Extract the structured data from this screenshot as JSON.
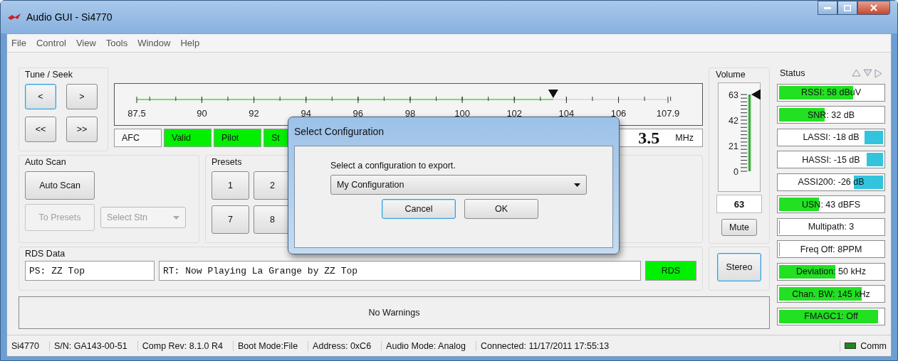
{
  "window": {
    "title": "Audio GUI - Si4770"
  },
  "menu": [
    "File",
    "Control",
    "View",
    "Tools",
    "Window",
    "Help"
  ],
  "tune_seek": {
    "title": "Tune / Seek",
    "buttons": [
      {
        "label": "<",
        "focused": true
      },
      {
        "label": ">",
        "focused": false
      },
      {
        "label": "<<",
        "focused": false
      },
      {
        "label": ">>",
        "focused": false
      }
    ]
  },
  "tuner": {
    "level": 0.784,
    "ticks": [
      "87.5",
      "90",
      "92",
      "94",
      "96",
      "98",
      "100",
      "102",
      "104",
      "106",
      "107.9"
    ],
    "indicators": [
      {
        "label": "AFC",
        "on": false
      },
      {
        "label": "Valid",
        "on": true
      },
      {
        "label": "Pilot",
        "on": true
      },
      {
        "label": "St",
        "on": true
      }
    ],
    "frequency": "3.5",
    "unit": "MHz"
  },
  "auto_scan": {
    "title": "Auto Scan",
    "scan_button": "Auto Scan",
    "presets_button": {
      "label": "To Presets",
      "disabled": true
    },
    "station_select": {
      "value": "Select Stn",
      "disabled": true
    }
  },
  "presets": {
    "title": "Presets",
    "buttons": [
      "1",
      "2",
      "7",
      "8"
    ]
  },
  "rds": {
    "title": "RDS Data",
    "ps": "PS: ZZ Top",
    "rt": "RT: Now Playing La Grange by ZZ Top",
    "indicator": {
      "label": "RDS",
      "on": true
    }
  },
  "warnings": "No Warnings",
  "volume": {
    "title": "Volume",
    "level": 1,
    "scale": [
      "63",
      "42",
      "21",
      "0"
    ],
    "value": "63",
    "mute": "Mute",
    "stereo": {
      "label": "Stereo",
      "on": true
    }
  },
  "status": {
    "title": "Status",
    "meters": [
      {
        "label": "RSSI: 58 dBuV",
        "level": 0.72,
        "color": "#22e022",
        "kind": "forward"
      },
      {
        "label": "SNR: 32 dB",
        "level": 0.45,
        "color": "#22e022",
        "kind": "forward"
      },
      {
        "label": "LASSI: -18 dB",
        "level": 0.2,
        "color": "#33c4dd",
        "kind": "reverse"
      },
      {
        "label": "HASSI: -15 dB",
        "level": 0.18,
        "color": "#33c4dd",
        "kind": "reverse"
      },
      {
        "label": "ASSI200: -26 dB",
        "level": 0.3,
        "color": "#33c4dd",
        "kind": "reverse"
      },
      {
        "label": "USN: 43 dBFS",
        "level": 0.4,
        "color": "#22e022",
        "kind": "forward"
      },
      {
        "label": "Multipath: 3",
        "level": 0.03,
        "color": "#22e022",
        "kind": "forward"
      },
      {
        "label": "Freq Off: 8PPM",
        "level": 0.03,
        "color": "#22e022",
        "kind": "forward"
      },
      {
        "label": "Deviation: 50 kHz",
        "level": 0.55,
        "color": "#22e022",
        "kind": "forward"
      },
      {
        "label": "Chan. BW: 145 kHz",
        "level": 0.8,
        "color": "#22e022",
        "kind": "forward"
      },
      {
        "label": "FMAGC1: Off",
        "level": 0.95,
        "color": "#22e022",
        "kind": "forward"
      }
    ]
  },
  "dialog": {
    "title": "Select Configuration",
    "prompt": "Select a configuration to export.",
    "selection": "My Configuration",
    "buttons": [
      {
        "label": "Cancel",
        "focused": true
      },
      {
        "label": "OK",
        "focused": false
      }
    ]
  },
  "status_bar": {
    "items": [
      "Si4770",
      "S/N: GA143-00-51",
      "Comp Rev: 8.1.0 R4",
      "Boot Mode:File",
      "Address: 0xC6",
      "Audio Mode: Analog",
      "Connected: 11/17/2011 17:55:13"
    ],
    "comm": {
      "label": "Comm",
      "color": "#1a8a1a"
    }
  }
}
